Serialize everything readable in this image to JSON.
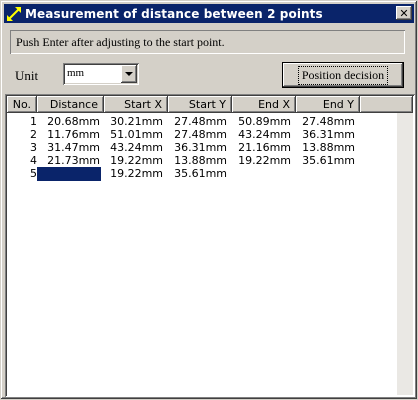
{
  "window": {
    "title": "Measurement of distance between 2 points",
    "close_label": "✕"
  },
  "message": "Push Enter after adjusting to the start point.",
  "unit": {
    "label": "Unit",
    "selected": "mm"
  },
  "position_button": "Position decision",
  "table": {
    "columns": [
      "No.",
      "Distance",
      "Start X",
      "Start Y",
      "End X",
      "End Y"
    ],
    "rows": [
      [
        "1",
        "20.68mm",
        "30.21mm",
        "27.48mm",
        "50.89mm",
        "27.48mm"
      ],
      [
        "2",
        "11.76mm",
        "51.01mm",
        "27.48mm",
        "43.24mm",
        "36.31mm"
      ],
      [
        "3",
        "31.47mm",
        "43.24mm",
        "36.31mm",
        "21.16mm",
        "13.88mm"
      ],
      [
        "4",
        "21.73mm",
        "19.22mm",
        "13.88mm",
        "19.22mm",
        "35.61mm"
      ],
      [
        "5",
        "",
        "19.22mm",
        "35.61mm",
        "",
        ""
      ]
    ]
  }
}
